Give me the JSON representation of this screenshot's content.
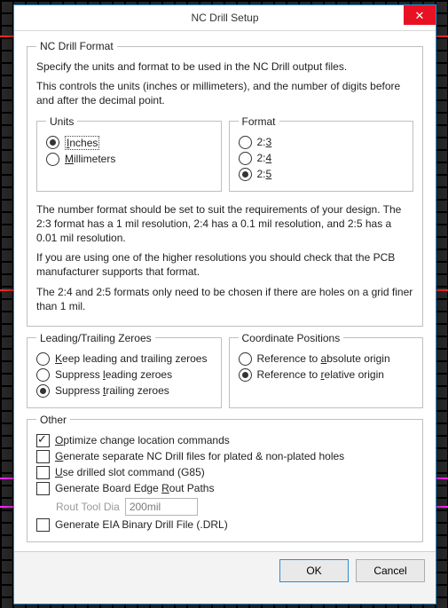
{
  "window": {
    "title": "NC Drill Setup",
    "close_tooltip": "Close"
  },
  "format_group": {
    "legend": "NC Drill Format",
    "intro": "Specify the units and format to be used in the NC Drill output files.",
    "desc": "This controls the units (inches or millimeters), and the number of digits before and after the decimal point.",
    "units_legend": "Units",
    "units": {
      "inches": "Inches",
      "millimeters": "Millimeters",
      "selected": "inches"
    },
    "fmt_legend": "Format",
    "fmt": {
      "o23": "2:3",
      "o24": "2:4",
      "o25": "2:5",
      "selected": "o25"
    },
    "note1": "The number format should be set to suit the requirements of your design. The 2:3 format has a 1 mil resolution, 2:4 has a 0.1 mil resolution, and 2:5 has a 0.01 mil resolution.",
    "note2": "If you are using one of the higher resolutions you should check that the PCB manufacturer supports that format.",
    "note3": "The 2:4 and 2:5 formats only need to be chosen if there are holes on a grid finer than 1 mil."
  },
  "zeroes_group": {
    "legend": "Leading/Trailing Zeroes",
    "keep": "Keep leading and trailing zeroes",
    "suppress_leading": "Suppress leading zeroes",
    "suppress_trailing": "Suppress trailing zeroes",
    "selected": "suppress_trailing"
  },
  "coord_group": {
    "legend": "Coordinate Positions",
    "absolute": "Reference to absolute origin",
    "relative": "Reference to relative origin",
    "selected": "relative"
  },
  "other_group": {
    "legend": "Other",
    "optimize": {
      "label": "Optimize change location commands",
      "checked": true
    },
    "separate": {
      "label": "Generate separate NC Drill files for plated & non-plated holes",
      "checked": false
    },
    "g85": {
      "label": "Use drilled slot command (G85)",
      "checked": false
    },
    "rout_paths": {
      "label": "Generate Board Edge Rout Paths",
      "checked": false
    },
    "rout_tool_label": "Rout Tool Dia",
    "rout_tool_value": "200mil",
    "eia": {
      "label": "Generate EIA Binary Drill File (.DRL)",
      "checked": false
    }
  },
  "buttons": {
    "ok": "OK",
    "cancel": "Cancel"
  }
}
